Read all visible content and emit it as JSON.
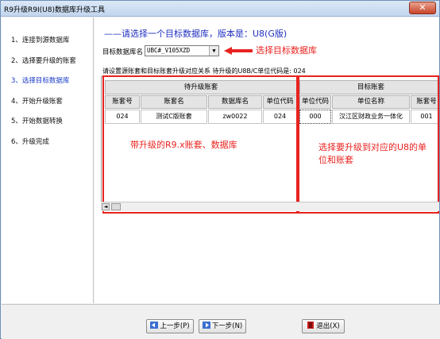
{
  "window": {
    "title": "R9升级R9I(U8)数据库升级工具",
    "close_glyph": "✕"
  },
  "steps": [
    {
      "label": "1、连接到源数据库"
    },
    {
      "label": "2、选择要升级的账套"
    },
    {
      "label": "3、选择目标数据库"
    },
    {
      "label": "4、开始升级账套"
    },
    {
      "label": "5、开始数据转换"
    },
    {
      "label": "6、升级完成"
    }
  ],
  "main": {
    "heading": "——请选择一个目标数据库，版本是：U8(G版)",
    "db_label": "目标数据库名",
    "db_value": "UBC#_V105XZD",
    "instruction": "请设置源账套和目标账套升级对应关系 待升级的U8B/C单位代码是:    024",
    "annotations": {
      "select_db": "选择目标数据库",
      "source_note": "带升级的R9.x账套、数据库",
      "target_note_1": "选择要升级到对应的U8的单",
      "target_note_2": "位和账套"
    }
  },
  "grid": {
    "source_group": "待升级账套",
    "target_group": "目标账套",
    "columns": [
      "账套号",
      "账套名",
      "数据库名",
      "单位代码",
      "单位代码",
      "单位名称",
      "账套号"
    ],
    "row": [
      "024",
      "测试C版账套",
      "zw0022",
      "024",
      "000",
      "汉江区财政业务一体化",
      "001"
    ]
  },
  "buttons": {
    "prev": "上一步(P)",
    "next": "下一步(N)",
    "exit": "退出(X)"
  },
  "colors": {
    "annotation": "#e8231f",
    "heading": "#2030c0",
    "active_step": "#1a3cc8"
  }
}
